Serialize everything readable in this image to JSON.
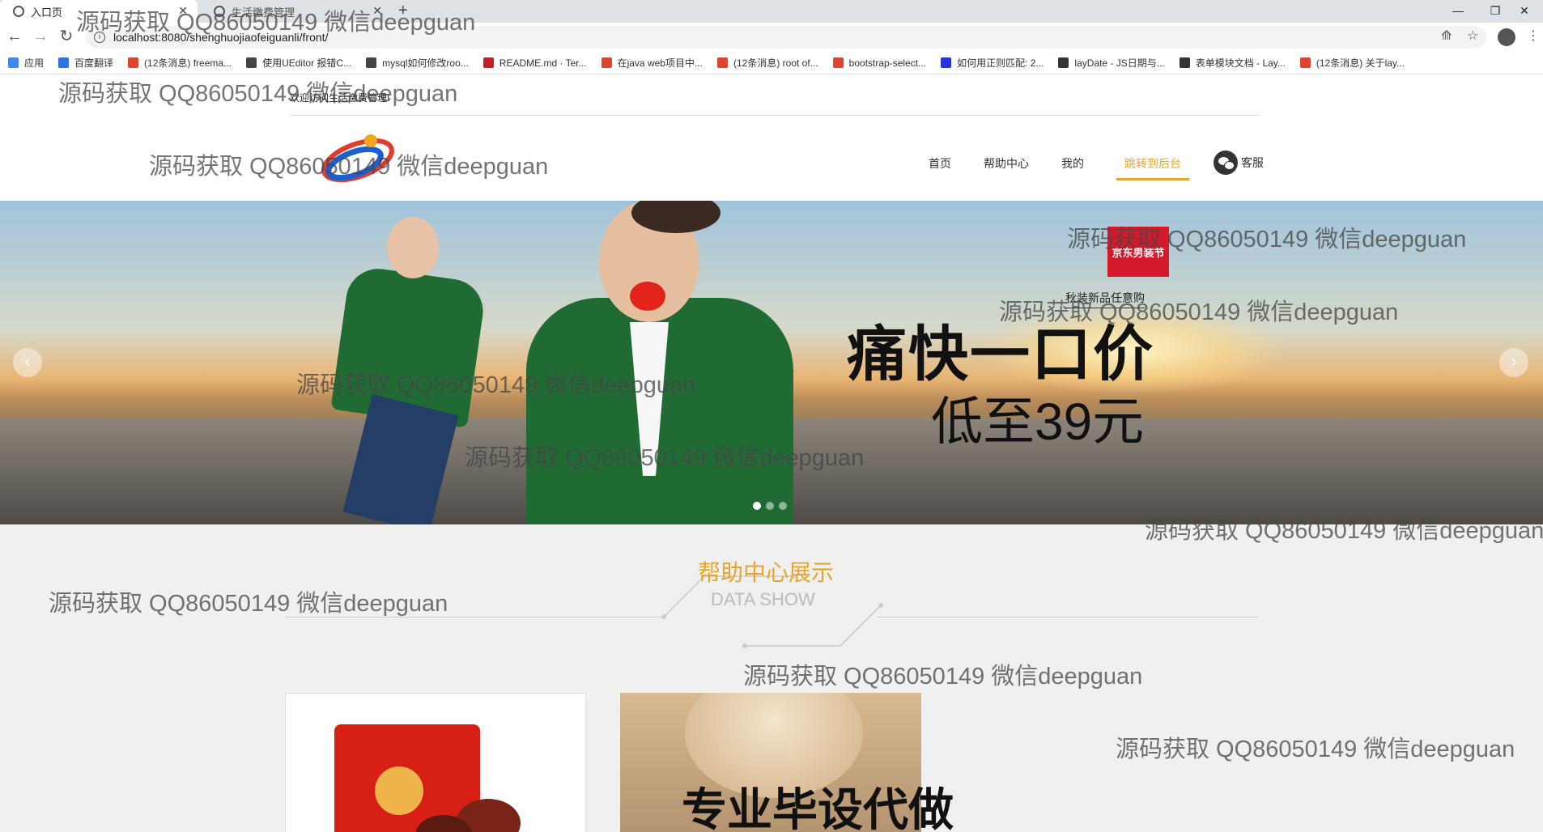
{
  "browser": {
    "tabs": [
      {
        "title": "入口页",
        "active": true
      },
      {
        "title": "生活缴费管理",
        "active": false
      }
    ],
    "new_tab": "+",
    "window_controls": [
      "—",
      "❐",
      "✕"
    ],
    "url": "localhost:8080/shenghuojiaofeiguanli/front/",
    "bookmarks": [
      {
        "label": "应用",
        "icon_color": "#4285f4"
      },
      {
        "label": "百度翻译",
        "icon_color": "#2a74e8"
      },
      {
        "label": "(12条消息) freema...",
        "icon_color": "#e0442c"
      },
      {
        "label": "使用UEditor 报错C...",
        "icon_color": "#444444"
      },
      {
        "label": "mysql如何修改roo...",
        "icon_color": "#444444"
      },
      {
        "label": "README.md · Ter...",
        "icon_color": "#c71d23"
      },
      {
        "label": "在java web项目中...",
        "icon_color": "#e0442c"
      },
      {
        "label": "(12条消息) root of...",
        "icon_color": "#e0442c"
      },
      {
        "label": "bootstrap-select...",
        "icon_color": "#e0442c"
      },
      {
        "label": "如何用正则匹配: 2...",
        "icon_color": "#2932e1"
      },
      {
        "label": "layDate - JS日期与...",
        "icon_color": "#333333"
      },
      {
        "label": "表单模块文档 - Lay...",
        "icon_color": "#333333"
      },
      {
        "label": "(12条消息) 关于lay...",
        "icon_color": "#e0442c"
      }
    ]
  },
  "header": {
    "welcome": "欢迎访问生活缴费管理!",
    "nav": [
      {
        "label": "首页",
        "active": false
      },
      {
        "label": "帮助中心",
        "active": false
      },
      {
        "label": "我的",
        "active": false
      },
      {
        "label": "跳转到后台",
        "active": true
      }
    ],
    "kefu": "客服",
    "accent": "#e8a52b"
  },
  "banner": {
    "badge": "京东男装节",
    "promo_small": "秋装新品任意购",
    "promo_big": "痛快一口价",
    "promo_price": "低至39元",
    "prev": "‹",
    "next": "›",
    "slides": 3,
    "current_slide": 1
  },
  "section": {
    "title_zh": "帮助中心展示",
    "title_en": "DATA SHOW",
    "card2_text": "专业毕设代做"
  },
  "watermark": "源码获取 QQ86050149 微信deepguan"
}
